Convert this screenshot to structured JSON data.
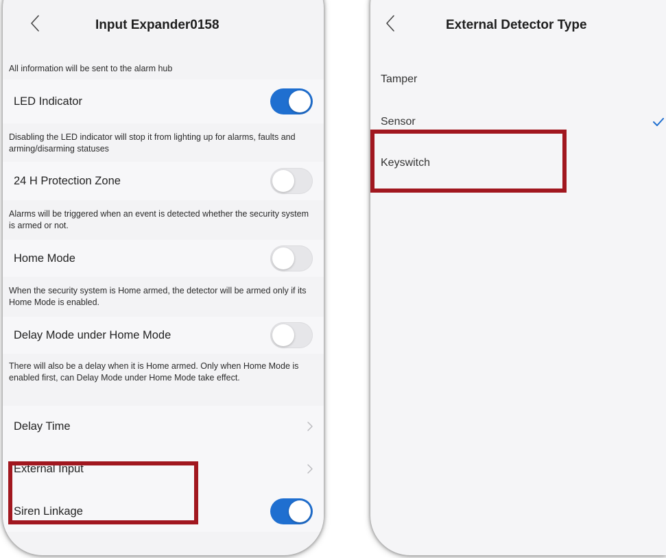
{
  "left_screen": {
    "title": "Input Expander0158",
    "hub_note": "All information will be sent to the alarm hub",
    "settings": [
      {
        "label": "LED Indicator",
        "toggle": true,
        "note": "Disabling the LED indicator will stop it from lighting up for alarms, faults and arming/disarming statuses"
      },
      {
        "label": "24 H Protection Zone",
        "toggle": false,
        "note": "Alarms will be triggered when an event is detected whether the security system is armed or not."
      },
      {
        "label": "Home Mode",
        "toggle": false,
        "note": "When the security system is Home armed, the detector will be armed only if its Home Mode is enabled."
      },
      {
        "label": "Delay Mode under Home Mode",
        "toggle": false,
        "note": "There will also be a delay when it is Home armed. Only when Home Mode is enabled first, can Delay Mode under Home Mode take effect."
      }
    ],
    "nav_rows": [
      {
        "label": "Delay Time"
      },
      {
        "label": "External Input"
      }
    ],
    "last_row": {
      "label": "Siren Linkage",
      "toggle": true
    }
  },
  "right_screen": {
    "title": "External Detector Type",
    "options": [
      {
        "label": "Tamper",
        "selected": false
      },
      {
        "label": "Sensor",
        "selected": true
      },
      {
        "label": "Keyswitch",
        "selected": false
      }
    ]
  },
  "colors": {
    "toggle_on": "#1f6fd0",
    "highlight_box": "#a1171f",
    "checkmark": "#1f6fd0"
  },
  "icons": {
    "back": "chevron-left-icon",
    "disclosure": "chevron-right-icon",
    "selected": "checkmark-icon"
  }
}
